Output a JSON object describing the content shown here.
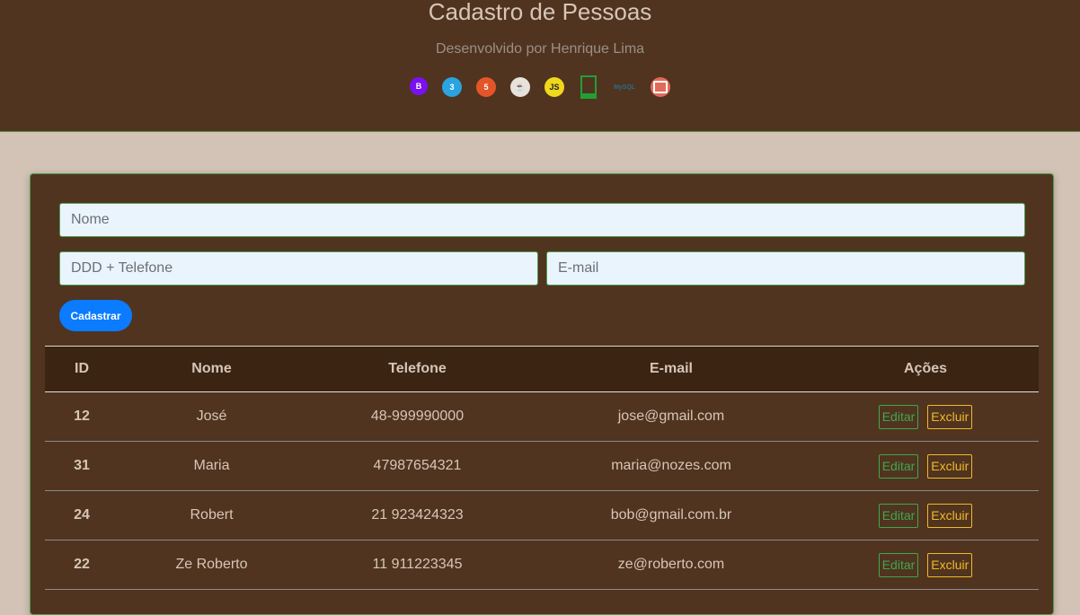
{
  "header": {
    "title": "Cadastro de Pessoas",
    "subtitle": "Desenvolvido por Henrique Lima",
    "tech_icons": [
      {
        "name": "bootstrap-icon",
        "glyph": "B"
      },
      {
        "name": "css3-icon",
        "glyph": "3"
      },
      {
        "name": "html5-icon",
        "glyph": "5"
      },
      {
        "name": "java-icon",
        "glyph": "☕"
      },
      {
        "name": "javascript-icon",
        "glyph": "JS"
      },
      {
        "name": "nodejs-icon",
        "glyph": ""
      },
      {
        "name": "mysql-icon",
        "glyph": "MySQL"
      },
      {
        "name": "printer-icon",
        "glyph": ""
      }
    ]
  },
  "form": {
    "nome_placeholder": "Nome",
    "telefone_placeholder": "DDD + Telefone",
    "email_placeholder": "E-mail",
    "submit_label": "Cadastrar"
  },
  "table": {
    "headers": [
      "ID",
      "Nome",
      "Telefone",
      "E-mail",
      "Ações"
    ],
    "edit_label": "Editar",
    "delete_label": "Excluir",
    "rows": [
      {
        "id": "12",
        "nome": "José",
        "telefone": "48-999990000",
        "email": "jose@gmail.com"
      },
      {
        "id": "31",
        "nome": "Maria",
        "telefone": "47987654321",
        "email": "maria@nozes.com"
      },
      {
        "id": "24",
        "nome": "Robert",
        "telefone": "21 923424323",
        "email": "bob@gmail.com.br"
      },
      {
        "id": "22",
        "nome": "Ze Roberto",
        "telefone": "11 911223345",
        "email": "ze@roberto.com"
      }
    ]
  },
  "colors": {
    "header_bg": "#50341f",
    "page_bg": "#d2c3b6",
    "accent_green": "#4fa050",
    "button_blue": "#0b7bff",
    "delete_yellow": "#f1b82a"
  }
}
